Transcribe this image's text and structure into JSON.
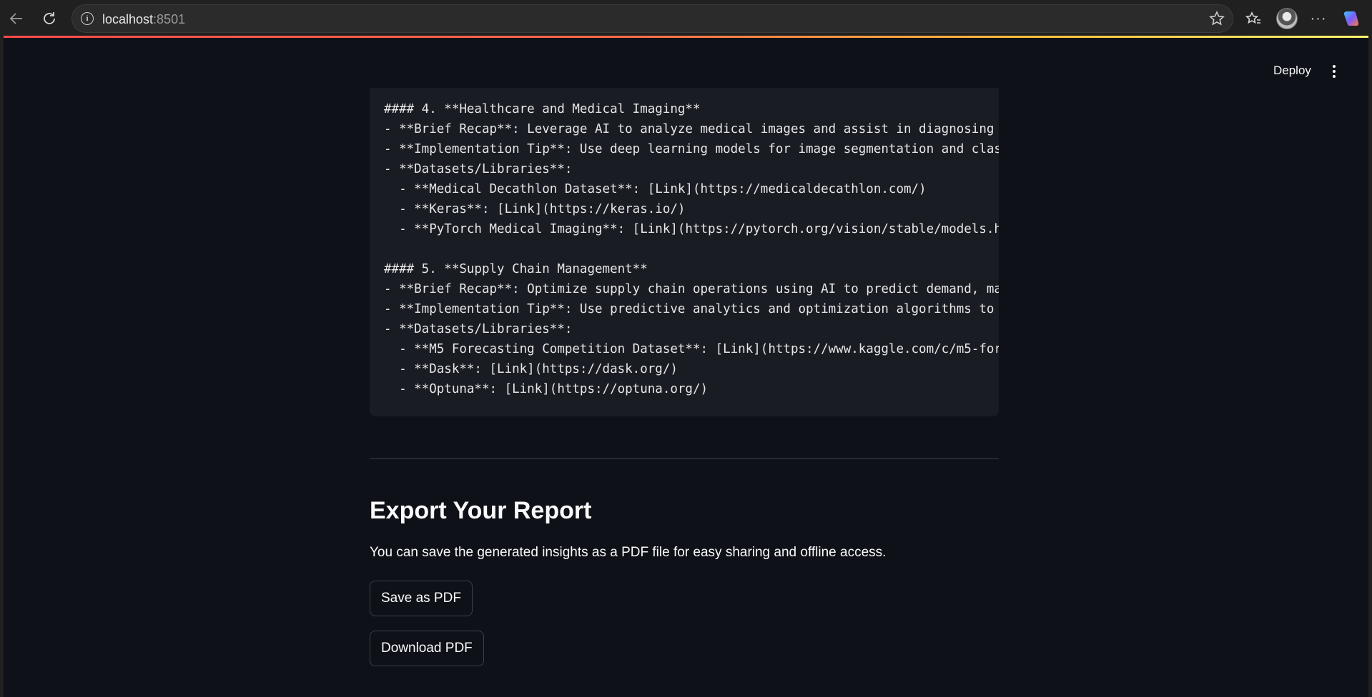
{
  "browser": {
    "url_host": "localhost",
    "url_port": ":8501"
  },
  "header": {
    "deploy_label": "Deploy"
  },
  "code_block": {
    "lines": [
      "#### 4. **Healthcare and Medical Imaging**",
      "- **Brief Recap**: Leverage AI to analyze medical images and assist in diagnosing",
      "- **Implementation Tip**: Use deep learning models for image segmentation and clas",
      "- **Datasets/Libraries**:",
      "  - **Medical Decathlon Dataset**: [Link](https://medicaldecathlon.com/)",
      "  - **Keras**: [Link](https://keras.io/)",
      "  - **PyTorch Medical Imaging**: [Link](https://pytorch.org/vision/stable/models.h",
      "",
      "#### 5. **Supply Chain Management**",
      "- **Brief Recap**: Optimize supply chain operations using AI to predict demand, ma",
      "- **Implementation Tip**: Use predictive analytics and optimization algorithms to",
      "- **Datasets/Libraries**:",
      "  - **M5 Forecasting Competition Dataset**: [Link](https://www.kaggle.com/c/m5-for",
      "  - **Dask**: [Link](https://dask.org/)",
      "  - **Optuna**: [Link](https://optuna.org/)"
    ]
  },
  "export": {
    "title": "Export Your Report",
    "description": "You can save the generated insights as a PDF file for easy sharing and offline access.",
    "save_label": "Save as PDF",
    "download_label": "Download PDF"
  }
}
